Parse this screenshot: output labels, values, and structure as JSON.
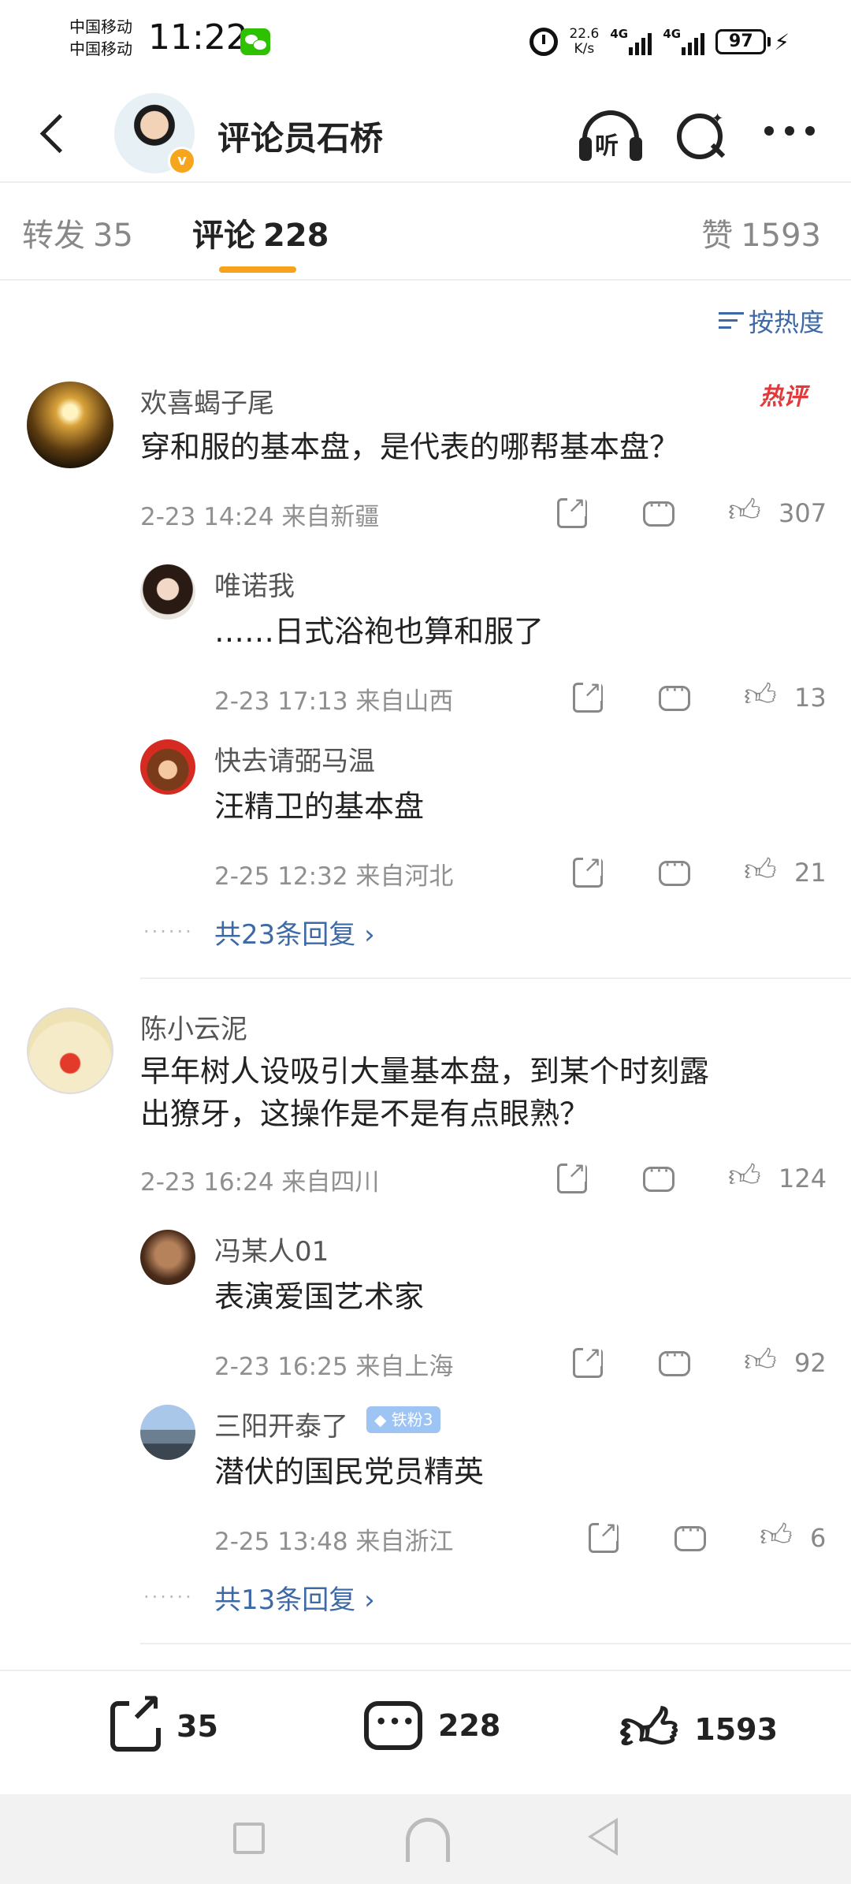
{
  "status_bar": {
    "carrier_1": "中国移动",
    "carrier_2": "中国移动",
    "time": "11:22",
    "net_speed_value": "22.6",
    "net_speed_unit": "K/s",
    "signal_1": "4G",
    "signal_2": "4G",
    "battery": "97"
  },
  "header": {
    "username": "评论员石桥",
    "listen_label": "听"
  },
  "tabs": {
    "repost_label": "转发",
    "repost_count": "35",
    "comment_label": "评论",
    "comment_count": "228",
    "like_label": "赞",
    "like_count": "1593"
  },
  "sort": {
    "label": "按热度"
  },
  "hot_badge": "热评",
  "comments": [
    {
      "user": "欢喜蝎子尾",
      "text": "穿和服的基本盘，是代表的哪帮基本盘？",
      "meta": "2-23 14:24 来自新疆",
      "likes": "307",
      "replies": [
        {
          "user": "唯诺我",
          "text": "……日式浴袍也算和服了",
          "meta": "2-23 17:13 来自山西",
          "likes": "13"
        },
        {
          "user": "快去请弼马温",
          "text": "汪精卫的基本盘",
          "meta": "2-25 12:32 来自河北",
          "likes": "21"
        }
      ],
      "more_replies": "共23条回复"
    },
    {
      "user": "陈小云泥",
      "text_line1": "早年树人设吸引大量基本盘，到某个时刻露",
      "text_line2": "出獠牙，这操作是不是有点眼熟？",
      "meta": "2-23 16:24 来自四川",
      "likes": "124",
      "replies": [
        {
          "user": "冯某人01",
          "text": "表演爱国艺术家",
          "meta": "2-23 16:25 来自上海",
          "likes": "92"
        },
        {
          "user": "三阳开泰了",
          "badge": "铁粉3",
          "text": "潜伏的国民党员精英",
          "meta": "2-25 13:48 来自浙江",
          "likes": "6"
        }
      ],
      "more_replies": "共13条回复"
    }
  ],
  "bottom_bar": {
    "repost_count": "35",
    "comment_count": "228",
    "like_count": "1593"
  },
  "colors": {
    "accent": "#f7a21d",
    "link": "#3d6aa6",
    "hot": "#e23a3a",
    "muted": "#909090"
  }
}
